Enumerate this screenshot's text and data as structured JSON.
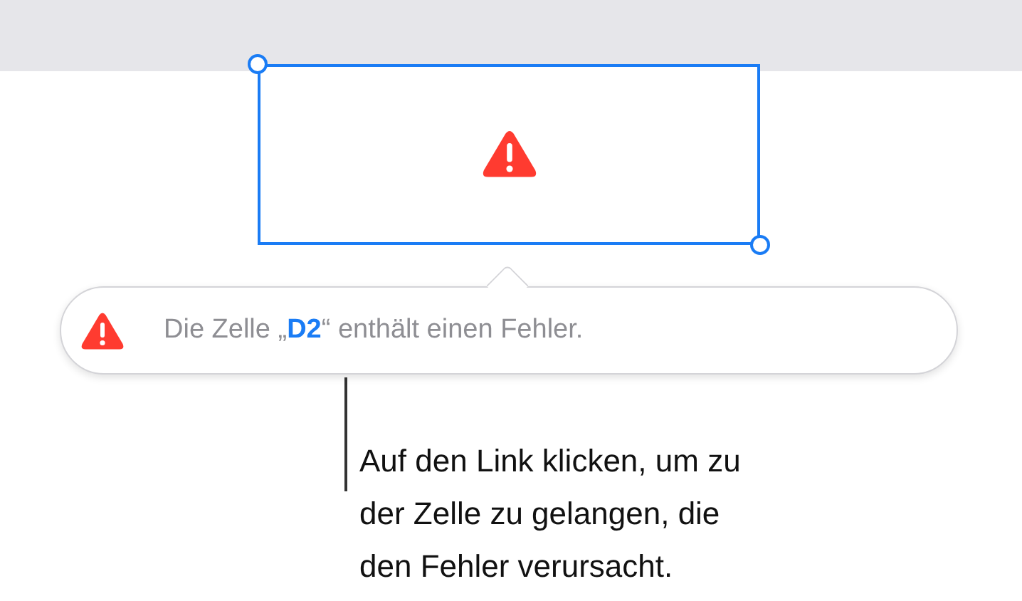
{
  "cell": {
    "selected": true,
    "has_error": true
  },
  "popover": {
    "message_before": "Die Zelle „",
    "link": "D2",
    "message_after": "“ enthält einen Fehler."
  },
  "callout": {
    "lines": [
      "Auf den Link klicken, um zu",
      "der Zelle zu gelangen, die",
      "den Fehler verursacht."
    ]
  }
}
